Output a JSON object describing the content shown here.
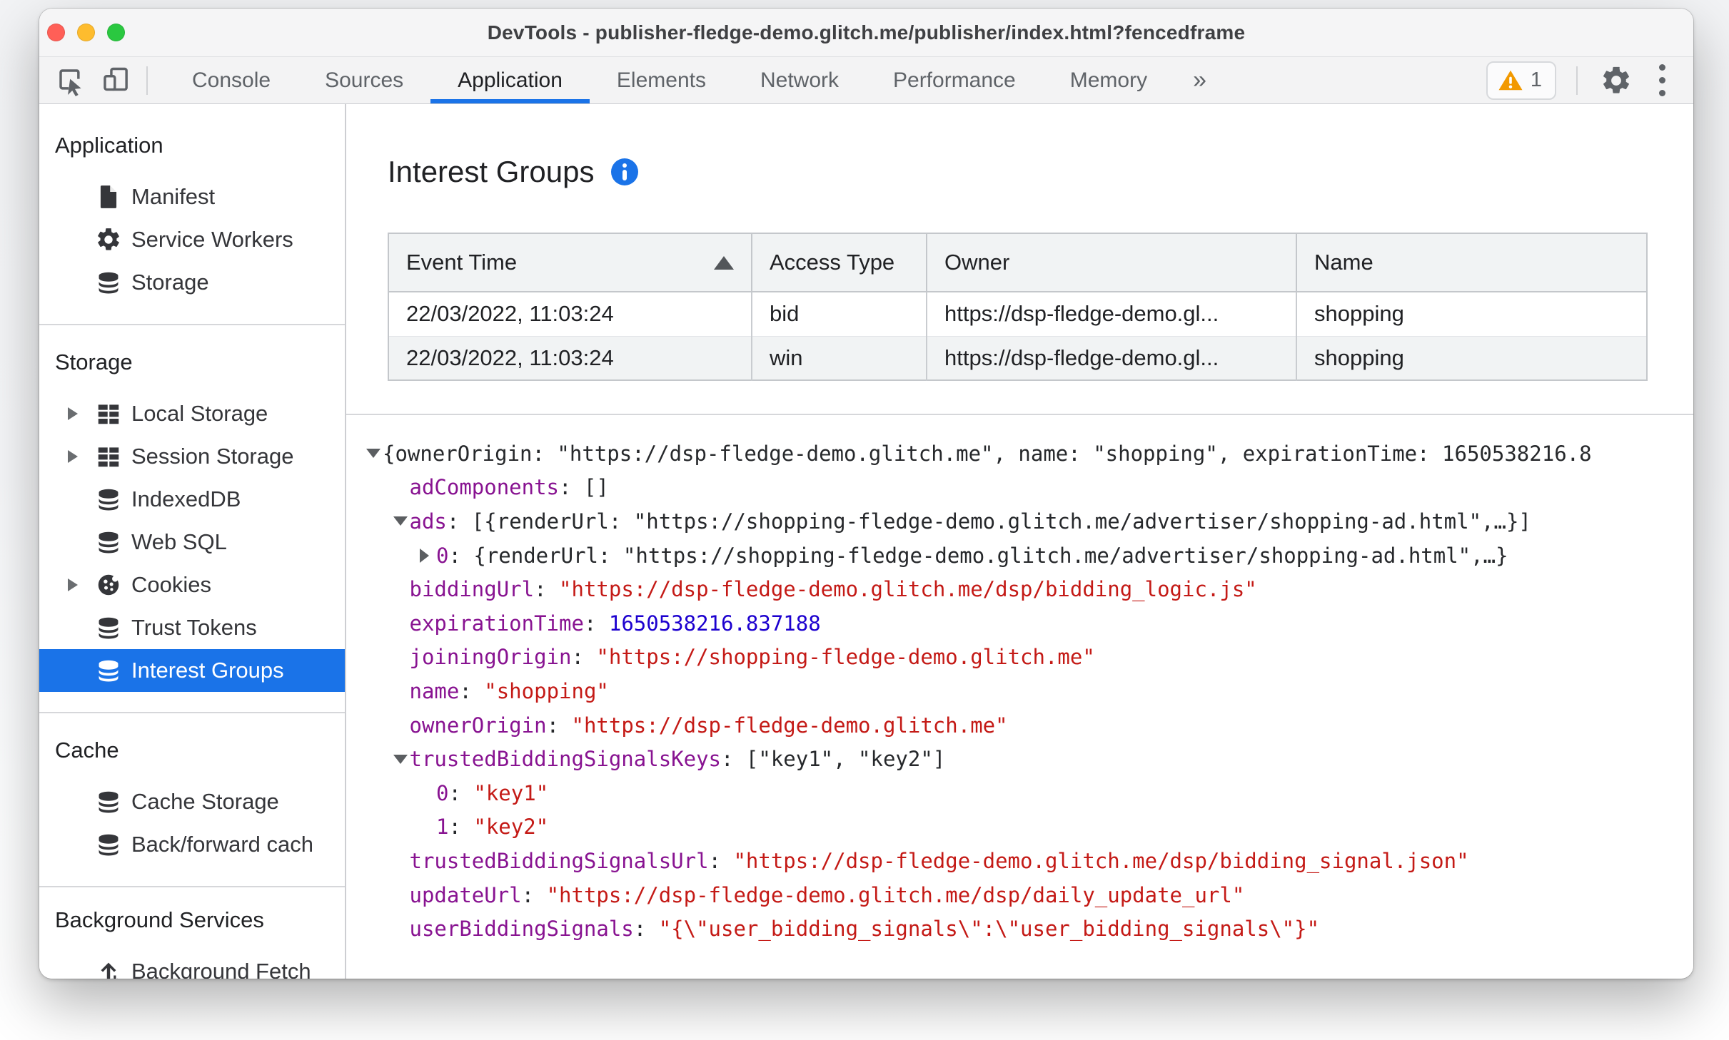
{
  "window": {
    "title": "DevTools - publisher-fledge-demo.glitch.me/publisher/index.html?fencedframe"
  },
  "colors": {
    "accent_blue": "#1a73e8",
    "warning_amber": "#f29900",
    "syntax_key_purple": "#881391",
    "syntax_string_red": "#c41a16",
    "syntax_number_blue": "#1c00cf"
  },
  "toolbar": {
    "tabs": [
      {
        "label": "Console",
        "selected": false
      },
      {
        "label": "Sources",
        "selected": false
      },
      {
        "label": "Application",
        "selected": true
      },
      {
        "label": "Elements",
        "selected": false
      },
      {
        "label": "Network",
        "selected": false
      },
      {
        "label": "Performance",
        "selected": false
      },
      {
        "label": "Memory",
        "selected": false
      }
    ],
    "more_tabs_label": "»",
    "warning_count": "1"
  },
  "sidebar": {
    "sections": [
      {
        "title": "Application",
        "items": [
          {
            "label": "Manifest",
            "icon": "file"
          },
          {
            "label": "Service Workers",
            "icon": "gear"
          },
          {
            "label": "Storage",
            "icon": "database"
          }
        ]
      },
      {
        "title": "Storage",
        "items": [
          {
            "label": "Local Storage",
            "icon": "table",
            "expandable": true
          },
          {
            "label": "Session Storage",
            "icon": "table",
            "expandable": true
          },
          {
            "label": "IndexedDB",
            "icon": "database"
          },
          {
            "label": "Web SQL",
            "icon": "database"
          },
          {
            "label": "Cookies",
            "icon": "cookie",
            "expandable": true
          },
          {
            "label": "Trust Tokens",
            "icon": "database"
          },
          {
            "label": "Interest Groups",
            "icon": "database",
            "selected": true
          }
        ]
      },
      {
        "title": "Cache",
        "items": [
          {
            "label": "Cache Storage",
            "icon": "database"
          },
          {
            "label": "Back/forward cach",
            "icon": "database"
          }
        ]
      },
      {
        "title": "Background Services",
        "items": [
          {
            "label": "Background Fetch",
            "icon": "fetch"
          }
        ]
      }
    ]
  },
  "interest_groups": {
    "title": "Interest Groups",
    "table": {
      "columns": [
        "Event Time",
        "Access Type",
        "Owner",
        "Name"
      ],
      "sorted_column": "Event Time",
      "sort_direction": "asc",
      "rows": [
        [
          "22/03/2022, 11:03:24",
          "bid",
          "https://dsp-fledge-demo.gl...",
          "shopping"
        ],
        [
          "22/03/2022, 11:03:24",
          "win",
          "https://dsp-fledge-demo.gl...",
          "shopping"
        ]
      ]
    },
    "tree": {
      "lines": [
        {
          "id": "root",
          "indent": 0,
          "arrow": "down",
          "segments": [
            [
              "p",
              "{ownerOrigin: \"https://dsp-fledge-demo.glitch.me\", name: \"shopping\", expirationTime: 1650538216.8"
            ]
          ]
        },
        {
          "id": "adComponents",
          "indent": 1,
          "arrow": null,
          "segments": [
            [
              "k",
              "adComponents"
            ],
            [
              "p",
              ": []"
            ]
          ]
        },
        {
          "id": "ads",
          "indent": 1,
          "arrow": "down",
          "segments": [
            [
              "k",
              "ads"
            ],
            [
              "p",
              ": [{renderUrl: \"https://shopping-fledge-demo.glitch.me/advertiser/shopping-ad.html\",…}]"
            ]
          ]
        },
        {
          "id": "ads-0",
          "indent": 2,
          "arrow": "right",
          "segments": [
            [
              "k",
              "0"
            ],
            [
              "p",
              ": {renderUrl: \"https://shopping-fledge-demo.glitch.me/advertiser/shopping-ad.html\",…}"
            ]
          ]
        },
        {
          "id": "biddingUrl",
          "indent": 1,
          "arrow": null,
          "segments": [
            [
              "k",
              "biddingUrl"
            ],
            [
              "p",
              ": "
            ],
            [
              "s",
              "\"https://dsp-fledge-demo.glitch.me/dsp/bidding_logic.js\""
            ]
          ]
        },
        {
          "id": "expirationTime",
          "indent": 1,
          "arrow": null,
          "segments": [
            [
              "k",
              "expirationTime"
            ],
            [
              "p",
              ": "
            ],
            [
              "n",
              "1650538216.837188"
            ]
          ]
        },
        {
          "id": "joiningOrigin",
          "indent": 1,
          "arrow": null,
          "segments": [
            [
              "k",
              "joiningOrigin"
            ],
            [
              "p",
              ": "
            ],
            [
              "s",
              "\"https://shopping-fledge-demo.glitch.me\""
            ]
          ]
        },
        {
          "id": "name",
          "indent": 1,
          "arrow": null,
          "segments": [
            [
              "k",
              "name"
            ],
            [
              "p",
              ": "
            ],
            [
              "s",
              "\"shopping\""
            ]
          ]
        },
        {
          "id": "ownerOrigin",
          "indent": 1,
          "arrow": null,
          "segments": [
            [
              "k",
              "ownerOrigin"
            ],
            [
              "p",
              ": "
            ],
            [
              "s",
              "\"https://dsp-fledge-demo.glitch.me\""
            ]
          ]
        },
        {
          "id": "trustedBiddingSignalsKeys",
          "indent": 1,
          "arrow": "down",
          "segments": [
            [
              "k",
              "trustedBiddingSignalsKeys"
            ],
            [
              "p",
              ": [\"key1\", \"key2\"]"
            ]
          ]
        },
        {
          "id": "keys-0",
          "indent": 2,
          "arrow": null,
          "segments": [
            [
              "k",
              "0"
            ],
            [
              "p",
              ": "
            ],
            [
              "s",
              "\"key1\""
            ]
          ]
        },
        {
          "id": "keys-1",
          "indent": 2,
          "arrow": null,
          "segments": [
            [
              "k",
              "1"
            ],
            [
              "p",
              ": "
            ],
            [
              "s",
              "\"key2\""
            ]
          ]
        },
        {
          "id": "trustedBiddingSignalsUrl",
          "indent": 1,
          "arrow": null,
          "segments": [
            [
              "k",
              "trustedBiddingSignalsUrl"
            ],
            [
              "p",
              ": "
            ],
            [
              "s",
              "\"https://dsp-fledge-demo.glitch.me/dsp/bidding_signal.json\""
            ]
          ]
        },
        {
          "id": "updateUrl",
          "indent": 1,
          "arrow": null,
          "segments": [
            [
              "k",
              "updateUrl"
            ],
            [
              "p",
              ": "
            ],
            [
              "s",
              "\"https://dsp-fledge-demo.glitch.me/dsp/daily_update_url\""
            ]
          ]
        },
        {
          "id": "userBiddingSignals",
          "indent": 1,
          "arrow": null,
          "segments": [
            [
              "k",
              "userBiddingSignals"
            ],
            [
              "p",
              ": "
            ],
            [
              "s",
              "\"{\\\"user_bidding_signals\\\":\\\"user_bidding_signals\\\"}\""
            ]
          ]
        }
      ]
    }
  }
}
